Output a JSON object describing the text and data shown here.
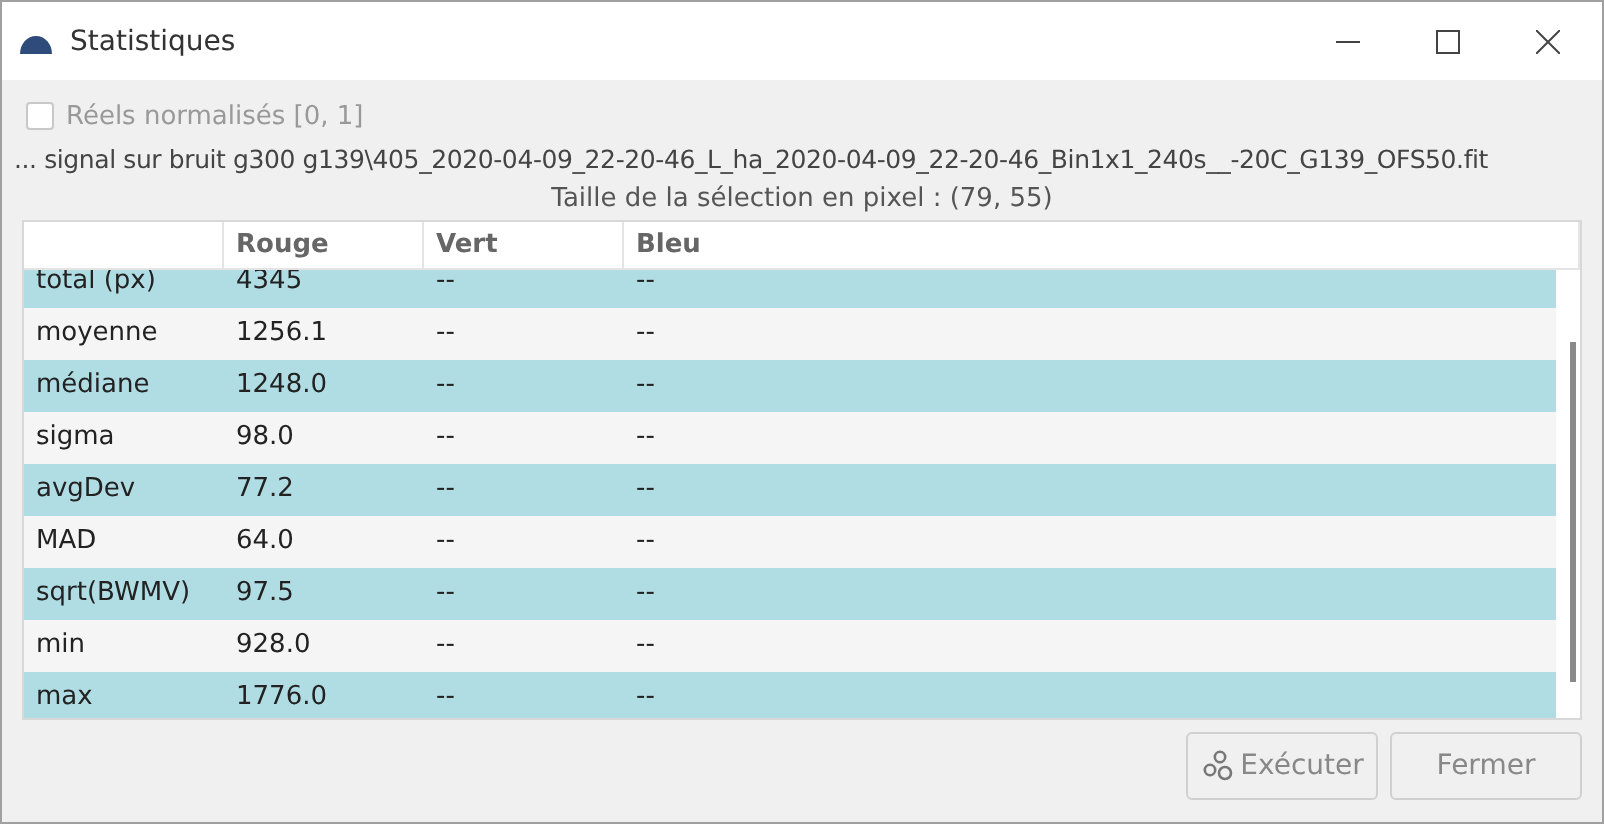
{
  "window": {
    "title": "Statistiques"
  },
  "checkbox": {
    "label": "Réels normalisés [0, 1]",
    "checked": false,
    "disabled": true
  },
  "file_path": "... signal sur bruit g300 g139\\405_2020-04-09_22-20-46_L_ha_2020-04-09_22-20-46_Bin1x1_240s__-20C_G139_OFS50.fit",
  "selection_size": "Taille de la sélection en pixel : (79, 55)",
  "table": {
    "columns": [
      "Rouge",
      "Vert",
      "Bleu"
    ],
    "rows": [
      {
        "name": "total (px)",
        "values": [
          "4345",
          "--",
          "--"
        ]
      },
      {
        "name": "moyenne",
        "values": [
          "1256.1",
          "--",
          "--"
        ]
      },
      {
        "name": "médiane",
        "values": [
          "1248.0",
          "--",
          "--"
        ]
      },
      {
        "name": "sigma",
        "values": [
          "98.0",
          "--",
          "--"
        ]
      },
      {
        "name": "avgDev",
        "values": [
          "77.2",
          "--",
          "--"
        ]
      },
      {
        "name": "MAD",
        "values": [
          "64.0",
          "--",
          "--"
        ]
      },
      {
        "name": "sqrt(BWMV)",
        "values": [
          "97.5",
          "--",
          "--"
        ]
      },
      {
        "name": "min",
        "values": [
          "928.0",
          "--",
          "--"
        ]
      },
      {
        "name": "max",
        "values": [
          "1776.0",
          "--",
          "--"
        ]
      }
    ]
  },
  "buttons": [
    {
      "label": "Exécuter",
      "kind": "run",
      "disabled": true
    },
    {
      "label": "Fermer",
      "kind": "close",
      "disabled": true
    }
  ]
}
